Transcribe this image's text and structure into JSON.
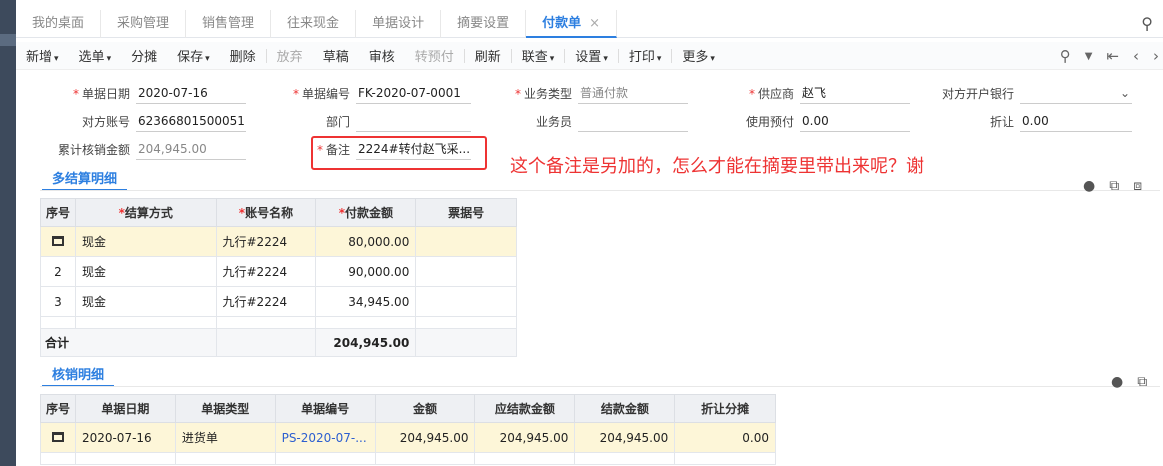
{
  "tabs": [
    "我的桌面",
    "采购管理",
    "销售管理",
    "往来现金",
    "单据设计",
    "摘要设置"
  ],
  "active_tab": "付款单",
  "active_tab_close": "×",
  "toolbar": {
    "items": [
      {
        "label": "新增",
        "caret": true
      },
      {
        "label": "选单",
        "caret": true
      },
      {
        "label": "分摊"
      },
      {
        "label": "保存",
        "caret": true
      },
      {
        "label": "删除"
      },
      {
        "label": "放弃",
        "disabled": true
      },
      {
        "label": "草稿"
      },
      {
        "label": "审核"
      },
      {
        "label": "转预付",
        "disabled": true
      },
      {
        "label": "刷新"
      },
      {
        "label": "联查",
        "caret": true
      },
      {
        "label": "设置",
        "caret": true
      },
      {
        "label": "打印",
        "caret": true
      },
      {
        "label": "更多",
        "caret": true
      }
    ],
    "right_icons": [
      "zoom-icon",
      "chevron-down-icon",
      "first-page-icon",
      "prev-icon",
      "next-icon"
    ]
  },
  "form": {
    "date_label": "单据日期",
    "date_value": "2020-07-16",
    "no_label": "单据编号",
    "no_value": "FK-2020-07-0001",
    "biz_type_label": "业务类型",
    "biz_type_value": "普通付款",
    "supplier_label": "供应商",
    "supplier_value": "赵飞",
    "bank_label": "对方开户银行",
    "bank_value": "",
    "account_label": "对方账号",
    "account_value": "62366801500051...",
    "dept_label": "部门",
    "dept_value": "",
    "staff_label": "业务员",
    "staff_value": "",
    "prepay_label": "使用预付",
    "prepay_value": "0.00",
    "discount_label": "折让",
    "discount_value": "0.00",
    "verify_total_label": "累计核销金额",
    "verify_total_value": "204,945.00",
    "remark_label": "备注",
    "remark_value": "2224#转付赵飞采..."
  },
  "annotation": "这个备注是另加的，怎么才能在摘要里带出来呢？谢",
  "settlement": {
    "title": "多结算明细",
    "headers": [
      "序号",
      "结算方式",
      "账号名称",
      "付款金额",
      "票据号"
    ],
    "rows": [
      {
        "no": "",
        "method": "现金",
        "account": "九行#2224",
        "amount": "80,000.00",
        "ticket": ""
      },
      {
        "no": "2",
        "method": "现金",
        "account": "九行#2224",
        "amount": "90,000.00",
        "ticket": ""
      },
      {
        "no": "3",
        "method": "现金",
        "account": "九行#2224",
        "amount": "34,945.00",
        "ticket": ""
      }
    ],
    "total_label": "合计",
    "total_value": "204,945.00"
  },
  "verify": {
    "title": "核销明细",
    "headers": [
      "序号",
      "单据日期",
      "单据类型",
      "单据编号",
      "金额",
      "应结款金额",
      "结款金额",
      "折让分摊"
    ],
    "rows": [
      {
        "no": "",
        "date": "2020-07-16",
        "type": "进货单",
        "doc": "PS-2020-07-...",
        "amount": "204,945.00",
        "due": "204,945.00",
        "paid": "204,945.00",
        "discount": "0.00"
      }
    ]
  }
}
